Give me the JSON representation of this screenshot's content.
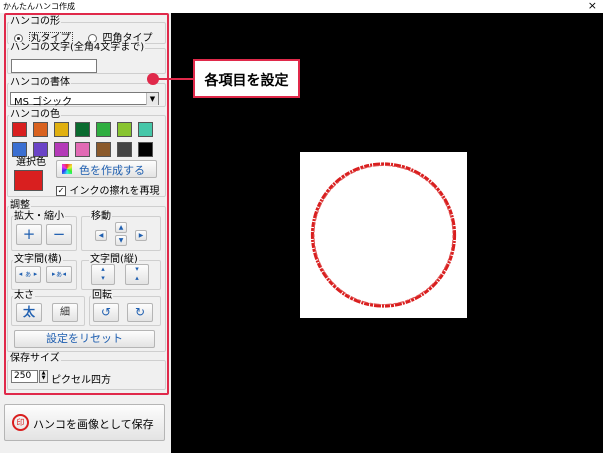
{
  "window": {
    "title": "かんたんハンコ作成",
    "close": "×"
  },
  "shape": {
    "label": "ハンコの形",
    "options": [
      "丸タイプ",
      "四角タイプ"
    ],
    "selected": "丸タイプ"
  },
  "text": {
    "label": "ハンコの文字(全角4文字まで)",
    "value": ""
  },
  "font": {
    "label": "ハンコの書体",
    "value": "MS ゴシック"
  },
  "color": {
    "label": "ハンコの色",
    "swatches": [
      "#d91f1f",
      "#d9621f",
      "#e0b010",
      "#0a6b2f",
      "#2fae40",
      "#88c430",
      "#46c7a9",
      "#3b6fd1",
      "#6a43c6",
      "#b43ab8",
      "#e26ab4",
      "#8b5a2b",
      "#444444",
      "#000000"
    ],
    "selected_label": "選択色",
    "selected_color": "#d91f1f",
    "create_button": "色を作成する",
    "ink_blur_label": "インクの擦れを再現",
    "ink_blur_checked": true
  },
  "adjust": {
    "label": "調整",
    "zoom_label": "拡大・縮小",
    "zoom_plus": "+",
    "zoom_minus": "−",
    "move_label": "移動",
    "spacing_h_label": "文字間(横)",
    "spacing_v_label": "文字間(縦)",
    "thickness_label": "太さ",
    "thick": "太",
    "thin": "細",
    "rotate_label": "回転",
    "reset_button": "設定をリセット"
  },
  "save_size": {
    "label": "保存サイズ",
    "value": "250",
    "unit": "ピクセル四方"
  },
  "save_button": "ハンコを画像として保存",
  "callout": "各項目を設定",
  "colors": {
    "accent": "#e0294a",
    "stamp": "#d91f1f"
  }
}
